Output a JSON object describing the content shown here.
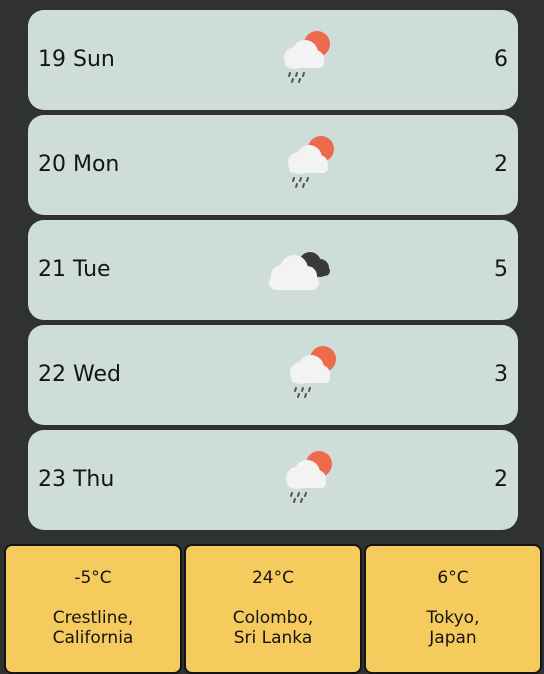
{
  "forecast": {
    "days": [
      {
        "label": "19 Sun",
        "value": "6",
        "icon": "sun-cloud-rain-icon"
      },
      {
        "label": "20 Mon",
        "value": "2",
        "icon": "sun-cloud-rain-icon"
      },
      {
        "label": "21 Tue",
        "value": "5",
        "icon": "dark-cloud-icon"
      },
      {
        "label": "22 Wed",
        "value": "3",
        "icon": "sun-cloud-rain-icon"
      },
      {
        "label": "23 Thu",
        "value": "2",
        "icon": "sun-cloud-rain-icon"
      }
    ]
  },
  "cities": [
    {
      "temp": "-5°C",
      "name_line1": "Crestline,",
      "name_line2": "California"
    },
    {
      "temp": "24°C",
      "name_line1": "Colombo,",
      "name_line2": "Sri Lanka"
    },
    {
      "temp": "6°C",
      "name_line1": "Tokyo,",
      "name_line2": "Japan"
    }
  ],
  "colors": {
    "background": "#303230",
    "day_card": "#cfddd8",
    "city_card": "#f6cb5e",
    "sun": "#ee6a4c",
    "dark_cloud": "#3a3a3a",
    "cloud": "#f3f3f3"
  }
}
